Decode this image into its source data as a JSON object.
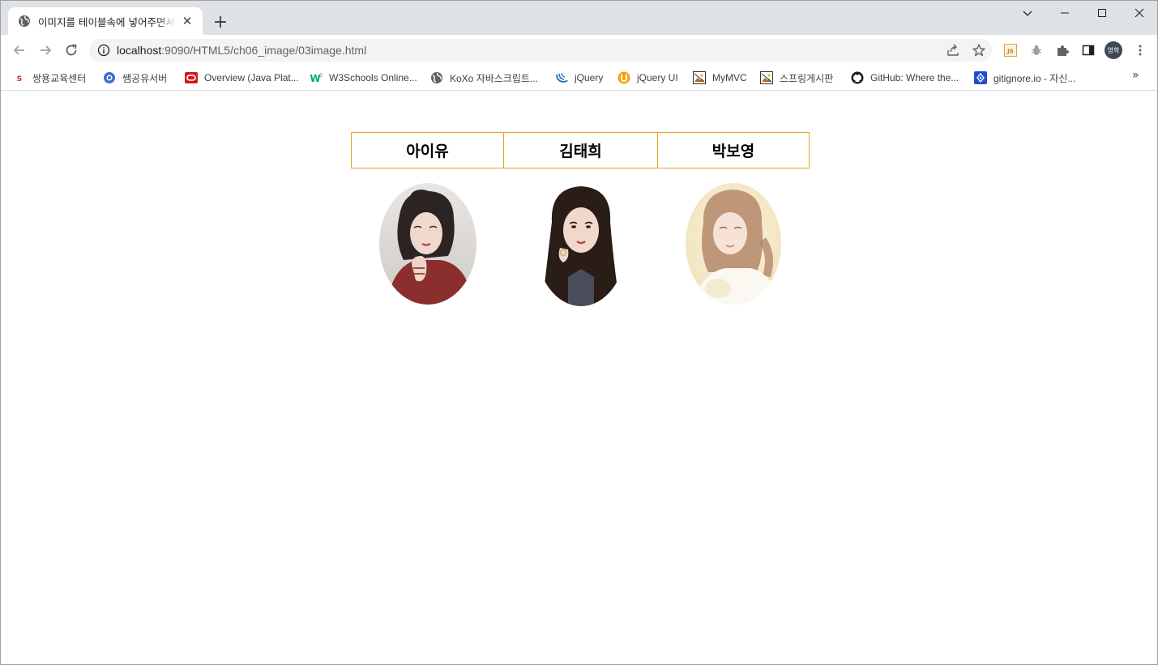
{
  "tab": {
    "title": "이미지를 테이블속에 넣어주면서",
    "close": "✕",
    "new_tab": "+"
  },
  "window_controls": {
    "dropdown": "⌄",
    "minimize": "—",
    "maximize": "☐",
    "close": "✕"
  },
  "toolbar": {
    "url_host": "localhost",
    "url_path": ":9090/HTML5/ch06_image/03image.html",
    "profile_initials": "영학"
  },
  "bookmarks": [
    {
      "label": "쌍용교육센터",
      "icon": "ssangyong-icon"
    },
    {
      "label": "쌤공유서버",
      "icon": "share-server-icon"
    },
    {
      "label": "Overview (Java Plat...",
      "icon": "oracle-icon"
    },
    {
      "label": "W3Schools Online...",
      "icon": "w3schools-icon"
    },
    {
      "label": "KoXo 자바스크립트...",
      "icon": "globe-icon"
    },
    {
      "label": "jQuery",
      "icon": "jquery-icon"
    },
    {
      "label": "jQuery UI",
      "icon": "jquery-ui-icon"
    },
    {
      "label": "MyMVC",
      "icon": "image-icon"
    },
    {
      "label": "스프링게시판",
      "icon": "image-icon"
    },
    {
      "label": "GitHub: Where the...",
      "icon": "github-icon"
    },
    {
      "label": "gitignore.io - 자신...",
      "icon": "gitignore-icon"
    }
  ],
  "bookmarks_more": "»",
  "table": {
    "headers": [
      "아이유",
      "김태희",
      "박보영"
    ],
    "border_color": "#e3a425"
  },
  "colors": {
    "tabstrip_bg": "#dee1e6",
    "omnibox_bg": "#f1f3f4",
    "table_border": "#e3a425"
  }
}
